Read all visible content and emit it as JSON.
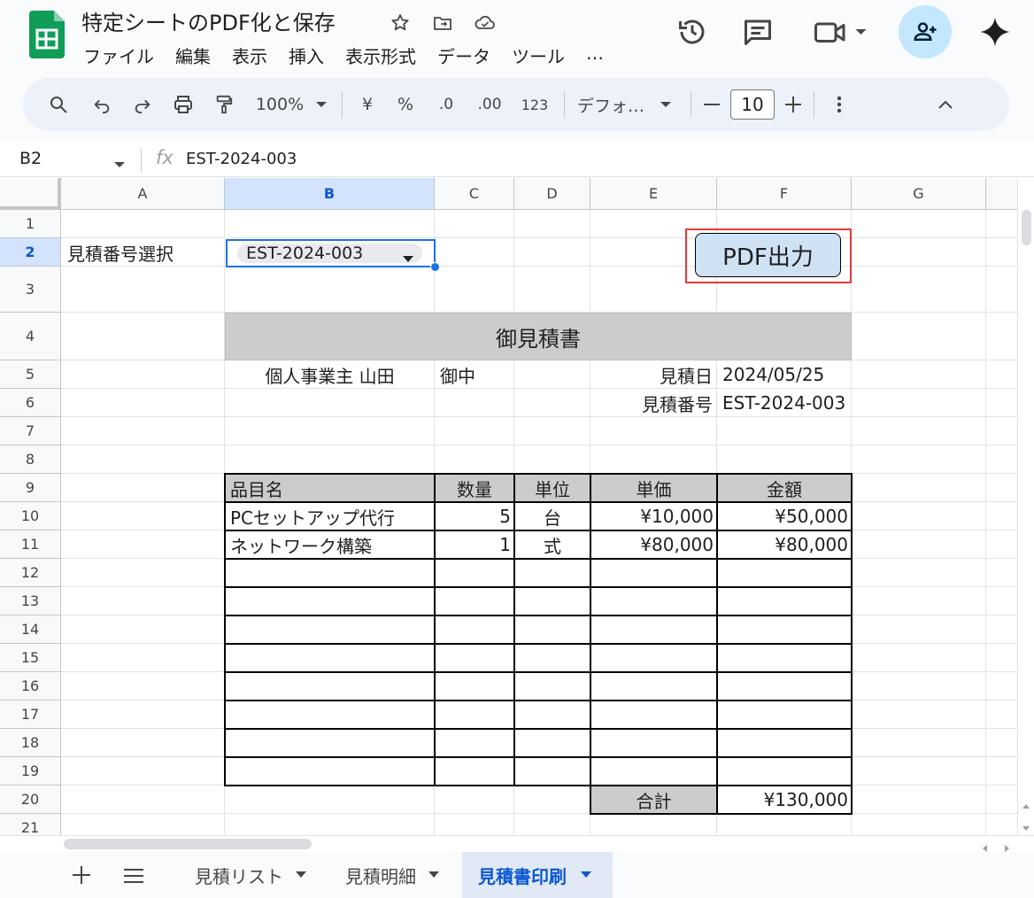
{
  "doc": {
    "title": "特定シートのPDF化と保存"
  },
  "menu": [
    "ファイル",
    "編集",
    "表示",
    "挿入",
    "表示形式",
    "データ",
    "ツール",
    "…"
  ],
  "toolbar": {
    "zoom": "100%",
    "currency": "¥",
    "percent": "%",
    "dec_less": ".0",
    "dec_more": ".00",
    "format_num": "123",
    "font": "デフォ…",
    "font_size": "10"
  },
  "formula_bar": {
    "cell_ref": "B2",
    "fx": "fx",
    "value": "EST-2024-003"
  },
  "columns": [
    "A",
    "B",
    "C",
    "D",
    "E",
    "F",
    "G"
  ],
  "rows": [
    "1",
    "2",
    "3",
    "4",
    "5",
    "6",
    "7",
    "8",
    "9",
    "10",
    "11",
    "12",
    "13",
    "14",
    "15",
    "16",
    "17",
    "18",
    "19",
    "20",
    "21"
  ],
  "sheet": {
    "a2": "見積番号選択",
    "b2_dropdown": "EST-2024-003",
    "pdf_button": "PDF出力",
    "heading": "御見積書",
    "client": "個人事業主 山田",
    "client_suffix": "御中",
    "date_label": "見積日",
    "date_value": "2024/05/25",
    "number_label": "見積番号",
    "number_value": "EST-2024-003",
    "table_headers": [
      "品目名",
      "数量",
      "単位",
      "単価",
      "金額"
    ],
    "items": [
      {
        "name": "PCセットアップ代行",
        "qty": "5",
        "unit": "台",
        "price": "¥10,000",
        "amount": "¥50,000"
      },
      {
        "name": "ネットワーク構築",
        "qty": "1",
        "unit": "式",
        "price": "¥80,000",
        "amount": "¥80,000"
      }
    ],
    "total_label": "合計",
    "total_value": "¥130,000"
  },
  "tabs": [
    {
      "label": "見積リスト",
      "active": false
    },
    {
      "label": "見積明細",
      "active": false
    },
    {
      "label": "見積書印刷",
      "active": true
    }
  ],
  "colors": {
    "selection": "#1a73e8",
    "header_fill": "#cccccc",
    "button_fill": "#cfe2f3",
    "highlight_border": "#e53935"
  }
}
